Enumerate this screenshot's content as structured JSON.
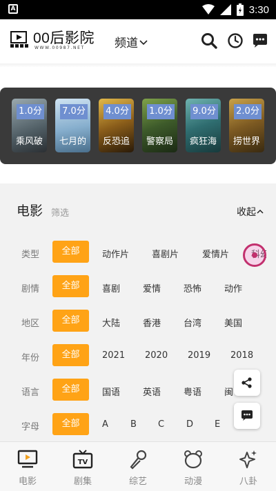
{
  "status_bar": {
    "time": "3:30",
    "app_icon_letter": "A"
  },
  "header": {
    "logo_title": "00后影院",
    "logo_subtitle": "WWW.00987.NET",
    "channel_label": "频道",
    "icons": [
      "search-icon",
      "history-icon",
      "message-icon"
    ]
  },
  "carousel": {
    "items": [
      {
        "score": "1.0分",
        "title": "乘风破",
        "color": "#6b7d86"
      },
      {
        "score": "7.0分",
        "title": "七月的",
        "color": "#8fb7d6"
      },
      {
        "score": "4.0分",
        "title": "反恐追",
        "color": "#7a5a1e"
      },
      {
        "score": "1.0分",
        "title": "警察局",
        "color": "#3f5a2f"
      },
      {
        "score": "9.0分",
        "title": "疯狂海",
        "color": "#3b6f74"
      },
      {
        "score": "2.0分",
        "title": "捞世界",
        "color": "#8a6a2a"
      }
    ]
  },
  "filter": {
    "title": "电影",
    "subtitle": "筛选",
    "collapse_label": "收起",
    "rows": [
      {
        "label": "类型",
        "selected": "全部",
        "options": [
          "动作片",
          "喜剧片",
          "爱情片",
          "科幻"
        ]
      },
      {
        "label": "剧情",
        "selected": "全部",
        "options": [
          "喜剧",
          "爱情",
          "恐怖",
          "动作"
        ]
      },
      {
        "label": "地区",
        "selected": "全部",
        "options": [
          "大陆",
          "香港",
          "台湾",
          "美国"
        ]
      },
      {
        "label": "年份",
        "selected": "全部",
        "options": [
          "2021",
          "2020",
          "2019",
          "2018"
        ]
      },
      {
        "label": "语言",
        "selected": "全部",
        "options": [
          "国语",
          "英语",
          "粤语",
          "闽"
        ]
      },
      {
        "label": "字母",
        "selected": "全部",
        "options": [
          "A",
          "B",
          "C",
          "D",
          "E"
        ]
      }
    ]
  },
  "floating": {
    "share_icon": "share-icon",
    "chat_icon": "chat-icon"
  },
  "tabbar": {
    "items": [
      {
        "label": "电影",
        "icon": "movie-icon"
      },
      {
        "label": "剧集",
        "icon": "tv-icon"
      },
      {
        "label": "综艺",
        "icon": "microphone-icon"
      },
      {
        "label": "动漫",
        "icon": "bear-icon"
      },
      {
        "label": "八卦",
        "icon": "sparkle-icon"
      }
    ]
  },
  "colors": {
    "accent": "#ffa316",
    "badge": "#6f8fd0",
    "strip": "#3a3a3a",
    "panel": "#f2f2f2"
  }
}
